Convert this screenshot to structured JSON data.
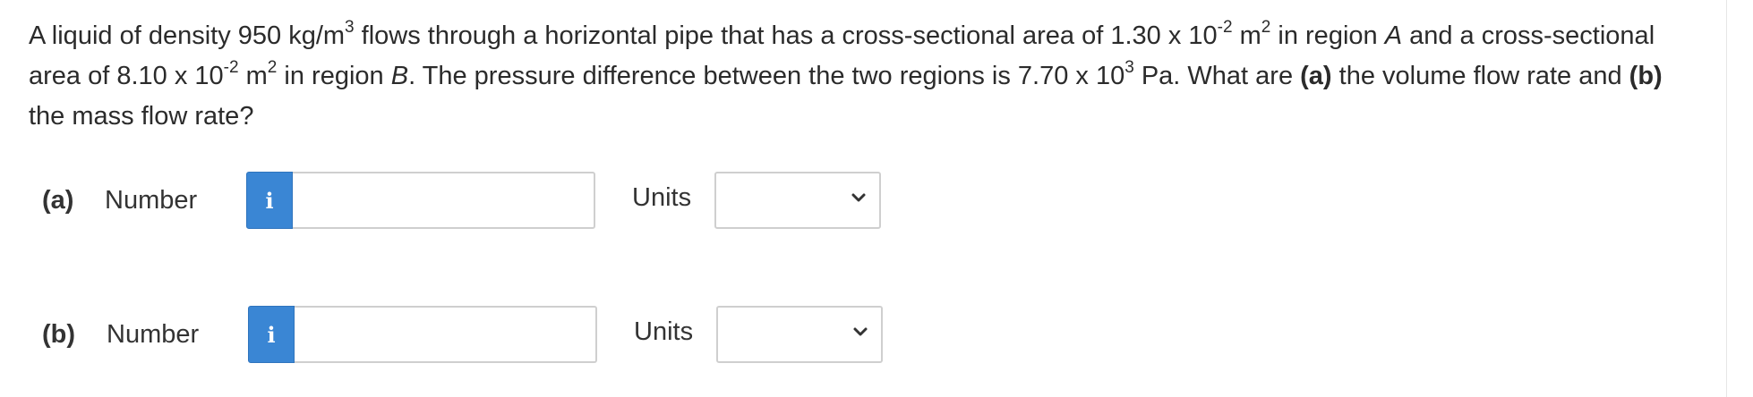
{
  "question": {
    "line1_a": "A liquid of density 950 kg/m",
    "line1_sup1": "3",
    "line1_b": " flows through a horizontal pipe that has a cross-sectional area of 1.30 x 10",
    "line1_sup2": "-2",
    "line1_c": " m",
    "line1_sup3": "2",
    "line1_d": " in region ",
    "region_a": "A",
    "line1_e": " and a cross-sectional area of 8.10 x 10",
    "line2_sup1": "-2",
    "line2_b": " m",
    "line2_sup2": "2",
    "line2_c": " in region ",
    "region_b": "B",
    "line2_d": ". The pressure difference between the two regions is 7.70 x 10",
    "line2_sup3": "3",
    "line2_e": " Pa. What are ",
    "part_a_ref": "(a)",
    "line2_f": " the volume flow rate and ",
    "part_b_ref": "(b)",
    "line3_a": " the mass flow rate?"
  },
  "answers": [
    {
      "part": "(a)",
      "number_label": "Number",
      "info_icon": "i",
      "number_value": "",
      "units_label": "Units",
      "units_selected": ""
    },
    {
      "part": "(b)",
      "number_label": "Number",
      "info_icon": "i",
      "number_value": "",
      "units_label": "Units",
      "units_selected": ""
    }
  ],
  "colors": {
    "info_button": "#3a86d4",
    "text": "#2b2b2b",
    "border": "#cfcfcf"
  }
}
